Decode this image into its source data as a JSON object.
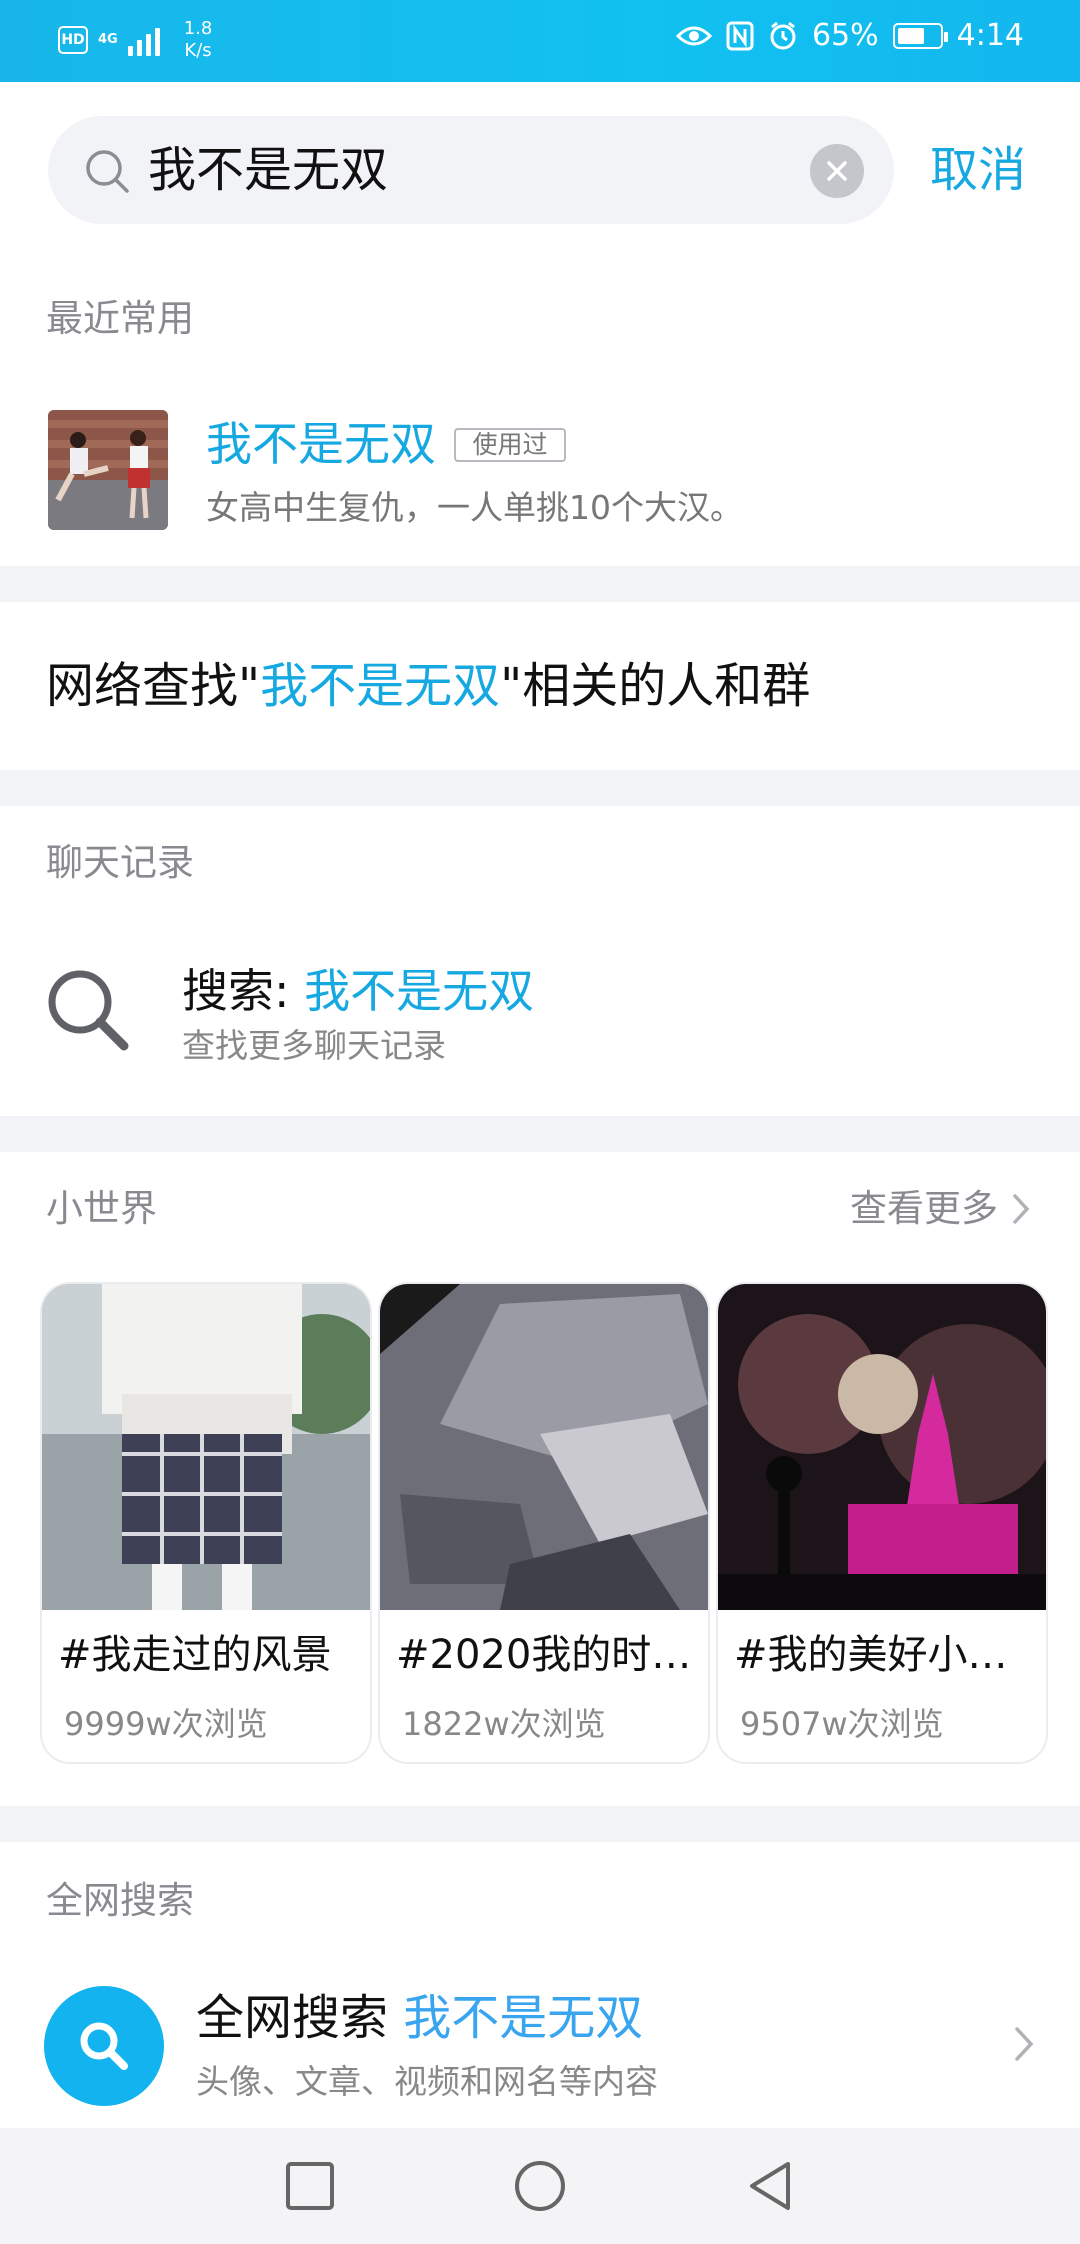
{
  "status_bar": {
    "hd": "HD",
    "network": "4G",
    "speed_value": "1.8",
    "speed_unit": "K/s",
    "battery_percent": "65%",
    "battery_level": 0.65,
    "time": "4:14"
  },
  "search": {
    "query": "我不是无双",
    "cancel_label": "取消"
  },
  "recent": {
    "label": "最近常用",
    "title": "我不是无双",
    "tag": "使用过",
    "description": "女高中生复仇，一人单挑10个大汉。"
  },
  "network_find": {
    "prefix": "网络查找\"",
    "keyword": "我不是无双",
    "suffix": "\"相关的人和群"
  },
  "chat_history": {
    "label": "聊天记录",
    "title_prefix": "搜索: ",
    "keyword": "我不是无双",
    "subtitle": "查找更多聊天记录"
  },
  "small_world": {
    "label": "小世界",
    "more_label": "查看更多",
    "cards": [
      {
        "title": "#我走过的风景",
        "views": "9999w次浏览"
      },
      {
        "title": "#2020我的时…",
        "views": "1822w次浏览"
      },
      {
        "title": "#我的美好小…",
        "views": "9507w次浏览"
      }
    ]
  },
  "web_search": {
    "label": "全网搜索",
    "title_prefix": "全网搜索 ",
    "keyword": "我不是无双",
    "subtitle": "头像、文章、视频和网名等内容"
  },
  "colors": {
    "accent": "#16a8e0",
    "status_bar": "#13b7ee",
    "divider": "#f2f3f6"
  }
}
